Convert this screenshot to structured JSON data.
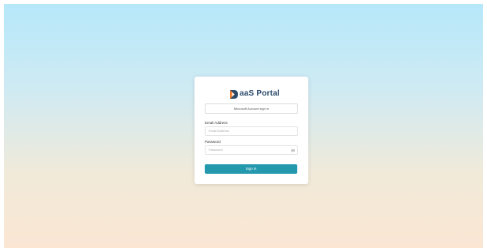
{
  "brand": {
    "logo_text": "aaS Portal",
    "logo_mark": "D"
  },
  "form": {
    "microsoft_button_label": "Microsoft Account sign in",
    "email_label": "Email Address",
    "email_placeholder": "Email Address",
    "password_label": "Password",
    "password_placeholder": "Password",
    "submit_label": "Sign in"
  },
  "icons": {
    "password_toggle": "eye-icon",
    "logo": "daas-logo-icon"
  },
  "colors": {
    "primary": "#2498ad",
    "logo_navy": "#2a4a6b",
    "logo_orange": "#f07a2a",
    "background_top": "#b6e8fa",
    "background_bottom": "#fbe6d3"
  }
}
